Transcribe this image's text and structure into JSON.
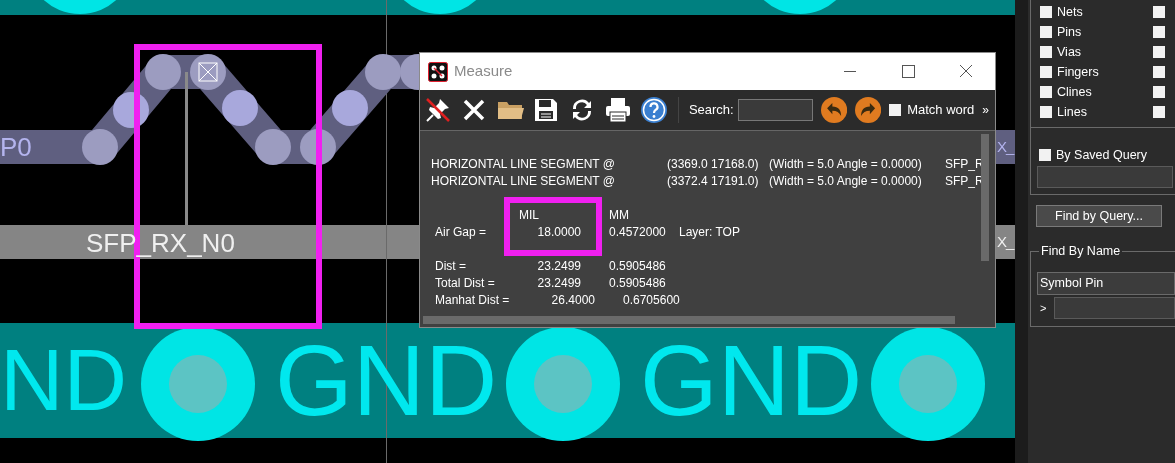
{
  "canvas": {
    "trace_label": "P0",
    "net_label": "SFP_RX_N0",
    "edge_labels": [
      "X_",
      "X_"
    ],
    "gnd_labels": [
      "ND",
      "GND",
      "GND"
    ]
  },
  "measure_window": {
    "title": "Measure",
    "toolbar": {
      "search_label": "Search:",
      "match_word": {
        "label": "Match word",
        "checked": false
      },
      "more": "»"
    },
    "segments": [
      {
        "label": "HORIZONTAL LINE SEGMENT @",
        "coords": "(3369.0 17168.0)",
        "props": "(Width = 5.0 Angle = 0.0000)",
        "net": "SFP_R"
      },
      {
        "label": "HORIZONTAL LINE SEGMENT @",
        "coords": "(3372.4 17191.0)",
        "props": "(Width = 5.0 Angle = 0.0000)",
        "net": "SFP_R"
      }
    ],
    "units": [
      "MIL",
      "MM"
    ],
    "air_gap": {
      "label": "Air Gap =",
      "mil": "18.0000",
      "mm": "0.4572000",
      "layer": "Layer: TOP"
    },
    "distances": [
      {
        "label": "Dist =",
        "mil": "23.2499",
        "mm": "0.5905486"
      },
      {
        "label": "Total Dist =",
        "mil": "23.2499",
        "mm": "0.5905486"
      },
      {
        "label": "Manhat Dist =",
        "mil": "26.4000",
        "mm": "0.6705600"
      }
    ]
  },
  "find_panel": {
    "object_types": [
      {
        "label": "Nets",
        "checked": false,
        "extra_checked": false
      },
      {
        "label": "Pins",
        "checked": false,
        "extra_checked": false
      },
      {
        "label": "Vias",
        "checked": false,
        "extra_checked": false
      },
      {
        "label": "Fingers",
        "checked": false,
        "extra_checked": false
      },
      {
        "label": "Clines",
        "checked": false,
        "extra_checked": false
      },
      {
        "label": "Lines",
        "checked": false,
        "extra_checked": false
      }
    ],
    "saved_query": {
      "label": "By Saved Query",
      "checked": false
    },
    "query_button": "Find by Query...",
    "find_by_name": {
      "title": "Find By Name",
      "type": "Symbol Pin",
      "prompt": ">"
    }
  }
}
